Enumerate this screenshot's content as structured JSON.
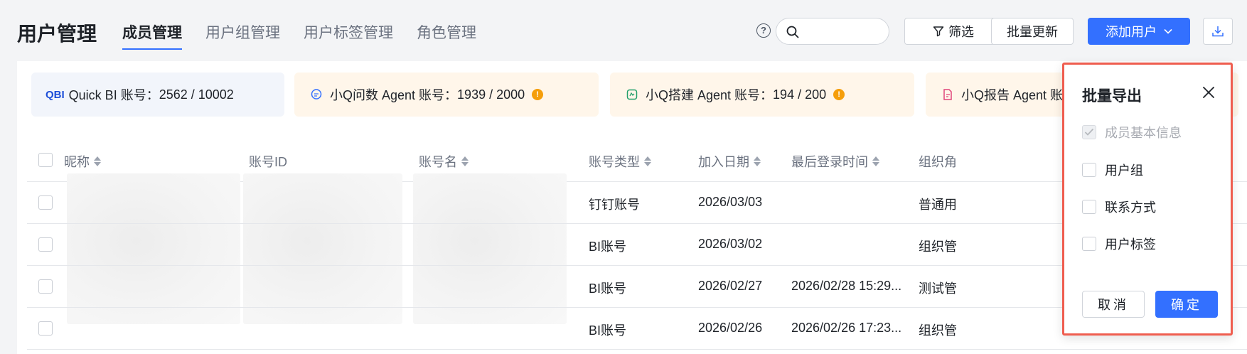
{
  "header": {
    "title": "用户管理",
    "tabs": [
      {
        "label": "成员管理",
        "active": true
      },
      {
        "label": "用户组管理",
        "active": false
      },
      {
        "label": "用户标签管理",
        "active": false
      },
      {
        "label": "角色管理",
        "active": false
      }
    ],
    "help_icon": "question-circle-icon",
    "search": {
      "placeholder": "",
      "value": ""
    },
    "filter_label": "筛选",
    "batch_update_label": "批量更新",
    "add_user_label": "添加用户",
    "download_icon": "download-icon",
    "accent_color": "#3370ff"
  },
  "quotas": [
    {
      "icon": "quick-bi-logo",
      "icon_text": "QBI",
      "label": "Quick BI 账号：",
      "value": "2562 / 10002",
      "warn": false
    },
    {
      "icon": "chat-bubble-icon",
      "label": "小Q问数 Agent 账号：",
      "value": "1939 / 2000",
      "warn": true
    },
    {
      "icon": "build-icon",
      "label": "小Q搭建 Agent 账号：",
      "value": "194 / 200",
      "warn": true
    },
    {
      "icon": "report-icon",
      "label": "小Q报告 Agent 账号",
      "value": "",
      "warn": false
    }
  ],
  "table": {
    "columns": [
      "昵称",
      "账号ID",
      "账号名",
      "账号类型",
      "加入日期",
      "最后登录时间",
      "组织角"
    ],
    "rows": [
      {
        "type": "钉钉账号",
        "joined": "2026/03/03",
        "last_login": "",
        "role": "普通用"
      },
      {
        "type": "BI账号",
        "joined": "2026/03/02",
        "last_login": "",
        "role": "组织管"
      },
      {
        "type": "BI账号",
        "joined": "2026/02/27",
        "last_login": "2026/02/28 15:29...",
        "role": "测试管"
      },
      {
        "type": "BI账号",
        "joined": "2026/02/26",
        "last_login": "2026/02/26 17:23...",
        "role": "组织管"
      }
    ]
  },
  "export_dropdown": {
    "title": "批量导出",
    "options": [
      {
        "label": "成员基本信息",
        "checked": true,
        "disabled": true
      },
      {
        "label": "用户组",
        "checked": false,
        "disabled": false
      },
      {
        "label": "联系方式",
        "checked": false,
        "disabled": false
      },
      {
        "label": "用户标签",
        "checked": false,
        "disabled": false
      }
    ],
    "cancel_label": "取消",
    "confirm_label": "确定",
    "highlight_color": "#ef5d4f"
  }
}
